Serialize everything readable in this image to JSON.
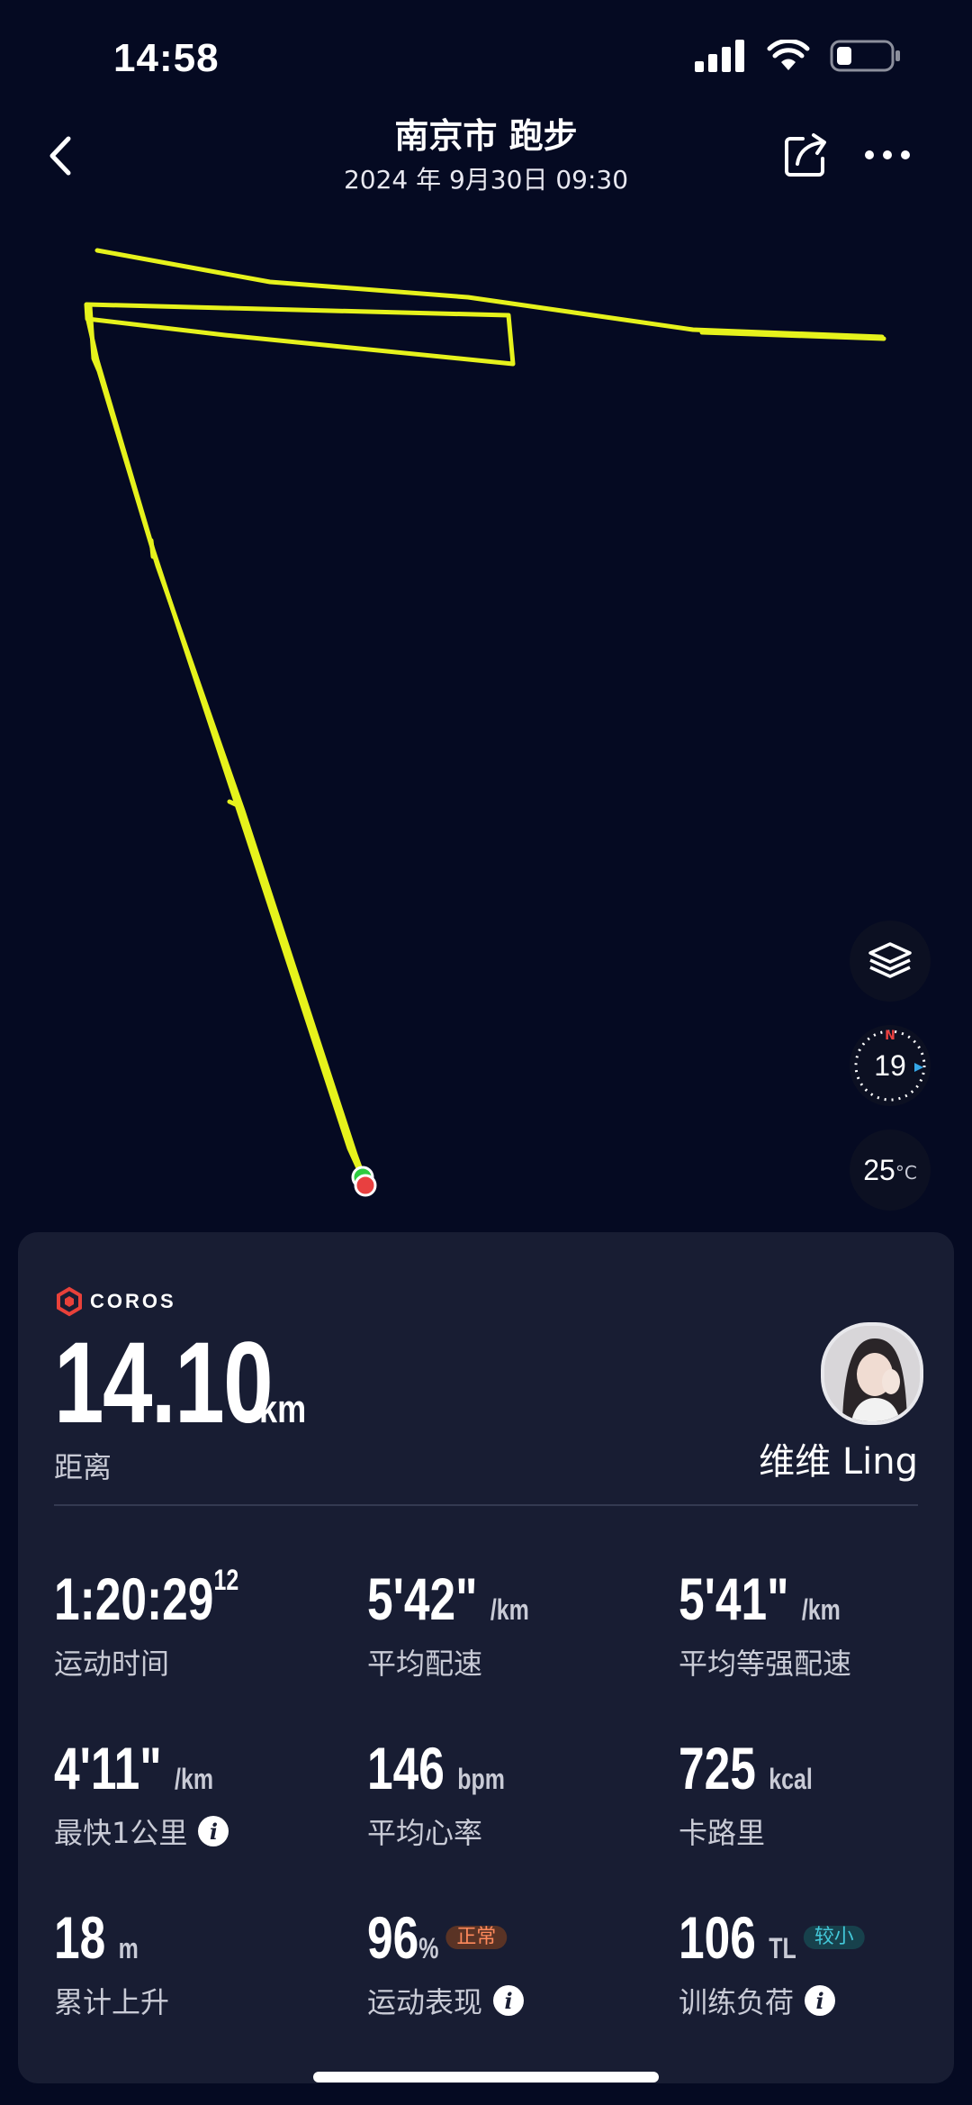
{
  "status": {
    "time": "14:58"
  },
  "header": {
    "title": "南京市 跑步",
    "datetime": "2024 年 9月30日 09:30"
  },
  "map": {
    "compass_value": "19",
    "compass_north": "N",
    "temperature": "25",
    "temperature_unit": "°C",
    "route_color": "#e6f21c",
    "start_color": "#2ecc40",
    "end_color": "#e84040"
  },
  "summary": {
    "brand": "COROS",
    "distance_value": "14.10",
    "distance_unit": "km",
    "distance_label": "距离",
    "user_name": "维维 Ling"
  },
  "stats": [
    {
      "value": "1:20:29",
      "sup": "12",
      "unit": "",
      "label": "运动时间"
    },
    {
      "value": "5'42\"",
      "unit": "/km",
      "label": "平均配速"
    },
    {
      "value": "5'41\"",
      "unit": "/km",
      "label": "平均等强配速"
    },
    {
      "value": "4'11\"",
      "unit": "/km",
      "label": "最快1公里",
      "info": "i"
    },
    {
      "value": "146",
      "unit": "bpm",
      "label": "平均心率"
    },
    {
      "value": "725",
      "unit": "kcal",
      "label": "卡路里"
    },
    {
      "value": "18",
      "unit": "m",
      "label": "累计上升"
    },
    {
      "value": "96",
      "unit": "%",
      "badge": "正常",
      "label": "运动表现",
      "info": "i"
    },
    {
      "value": "106",
      "unit": "TL",
      "badge": "较小",
      "label": "训练负荷",
      "info": "i"
    }
  ],
  "icons": {
    "back": "chevron-left-icon",
    "share": "share-icon",
    "more": "more-icon",
    "layers": "layers-icon",
    "compass": "compass-icon",
    "info": "info-icon"
  },
  "colors": {
    "background": "#050a22",
    "panel": "#181d33",
    "badge_normal": "#ff8a5c",
    "badge_low": "#43c8d9"
  }
}
